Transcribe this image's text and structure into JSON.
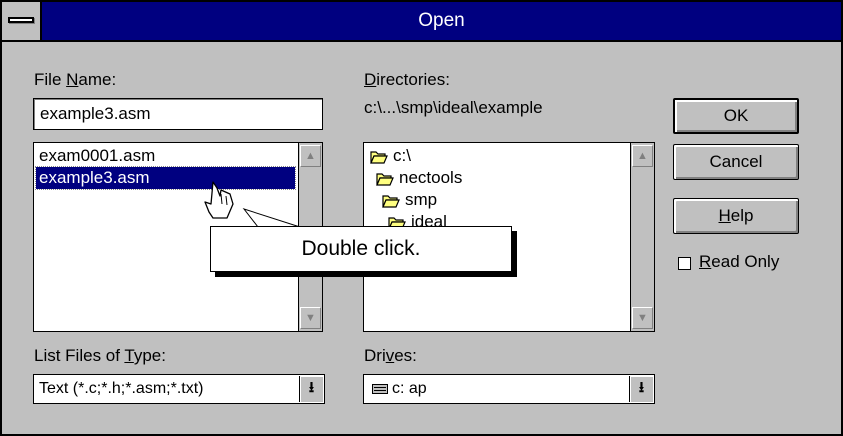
{
  "window": {
    "title": "Open"
  },
  "file_name": {
    "label_pre": "File ",
    "label_key": "N",
    "label_post": "ame:",
    "value": "example3.asm",
    "files": [
      "exam0001.asm",
      "example3.asm"
    ],
    "selected_index": 1
  },
  "directories": {
    "label_key": "D",
    "label_post": "irectories:",
    "current_path": "c:\\...\\smp\\ideal\\example",
    "tree": [
      "c:\\",
      "nectools",
      "smp",
      "ideal"
    ]
  },
  "buttons": {
    "ok": "OK",
    "cancel": "Cancel",
    "help_key": "H",
    "help_post": "elp"
  },
  "read_only": {
    "label_key": "R",
    "label_post": "ead Only",
    "checked": false
  },
  "file_type": {
    "label_pre": "List Files of ",
    "label_key": "T",
    "label_post": "ype:",
    "value": "Text (*.c;*.h;*.asm;*.txt)"
  },
  "drives": {
    "label_pre": "Dri",
    "label_key": "v",
    "label_post": "es:",
    "value": "c: ap"
  },
  "callout": {
    "text": "Double click."
  },
  "icons": {
    "scroll_up": "▲",
    "scroll_down": "▼",
    "dropdown": "⭳"
  },
  "colors": {
    "titlebar": "#000080",
    "face": "#c0c0c0",
    "selection": "#000080",
    "folder": "#ffff80"
  }
}
